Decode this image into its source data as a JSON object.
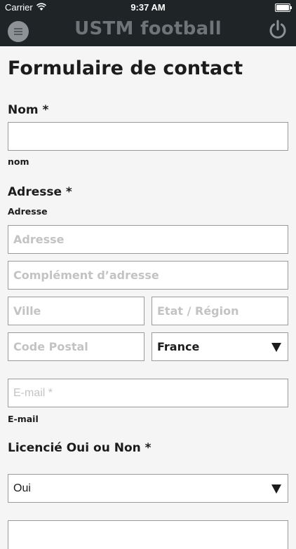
{
  "status_bar": {
    "carrier": "Carrier",
    "time": "9:37 AM"
  },
  "nav": {
    "title": "USTM football"
  },
  "form": {
    "title": "Formulaire de contact",
    "nom": {
      "label": "Nom *",
      "value": "",
      "sublabel": "nom"
    },
    "adresse": {
      "label": "Adresse *",
      "sublabel": "Adresse",
      "address_placeholder": "Adresse",
      "complement_placeholder": "Complément d’adresse",
      "city_placeholder": "Ville",
      "region_placeholder": "Etat / Région",
      "postal_placeholder": "Code Postal",
      "country": "France"
    },
    "email": {
      "placeholder": "E-mail *",
      "sublabel": "E-mail"
    },
    "licencie": {
      "label": "Licencié Oui ou Non  *",
      "value": "Oui"
    }
  }
}
